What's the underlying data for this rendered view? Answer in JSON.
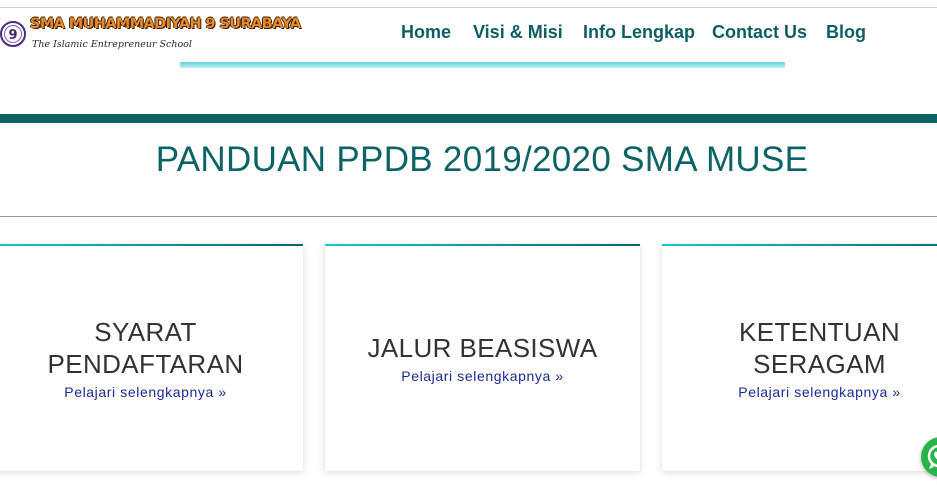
{
  "header": {
    "logo": {
      "title": "SMA MUHAMMADIYAH 9 SURABAYA",
      "tagline": "The Islamic Entrepreneur School",
      "emblem_text": "9"
    },
    "nav": [
      {
        "label": "Home"
      },
      {
        "label": "Visi & Misi"
      },
      {
        "label": "Info Lengkap"
      },
      {
        "label": "Contact Us"
      },
      {
        "label": "Blog"
      }
    ]
  },
  "main": {
    "title": "PANDUAN PPDB 2019/2020 SMA MUSE",
    "cards": [
      {
        "title_line1": "SYARAT",
        "title_line2": "PENDAFTARAN",
        "link": "Pelajari selengkapnya »"
      },
      {
        "title_line1": "JALUR BEASISWA",
        "title_line2": "",
        "link": "Pelajari selengkapnya »"
      },
      {
        "title_line1": "KETENTUAN",
        "title_line2": "SERAGAM",
        "link": "Pelajari selengkapnya »"
      }
    ]
  },
  "colors": {
    "primary": "#0c6366",
    "accent": "#19c7d2",
    "link": "#1a2a99",
    "whatsapp": "#27b449"
  },
  "icons": {
    "emblem": "school-emblem-icon",
    "whatsapp": "whatsapp-icon"
  }
}
